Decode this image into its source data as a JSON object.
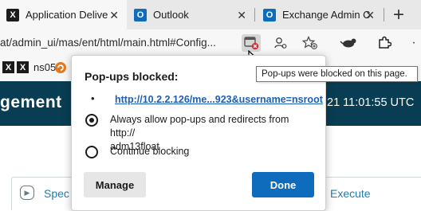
{
  "tabs": [
    {
      "title": "Application Delive",
      "icon": "netscaler-x-icon"
    },
    {
      "title": "Outlook",
      "icon": "outlook-icon"
    },
    {
      "title": "Exchange Admin C",
      "icon": "outlook-icon"
    }
  ],
  "address_bar": {
    "url": "at/admin_ui/mas/ent/html/main.html#Config..."
  },
  "bookmarks": [
    {
      "label": "ns05",
      "icon": "netscaler-x-icon"
    },
    {
      "label": "",
      "icon": "swirl-icon"
    }
  ],
  "page": {
    "title": "gement",
    "datetime": "21 11:01:55 UTC",
    "left_link": "Spec",
    "right_link": "Execute"
  },
  "popup": {
    "title": "Pop-ups blocked:",
    "blocked_link": "http://10.2.2.126/me...923&username=nsroot",
    "option_allow": "Always allow pop-ups and redirects from http://adm13float",
    "option_allow_line1": "Always allow pop-ups and redirects from http://",
    "option_allow_line2": "adm13float",
    "option_block": "Continue blocking",
    "manage_label": "Manage",
    "done_label": "Done",
    "selected_option": "allow"
  },
  "tooltip": "Pop-ups were blocked on this page.",
  "colors": {
    "header_bg": "#093d53",
    "done_button": "#0f6cbd",
    "link": "#1a5fb4",
    "blocked_badge": "#d13438"
  }
}
